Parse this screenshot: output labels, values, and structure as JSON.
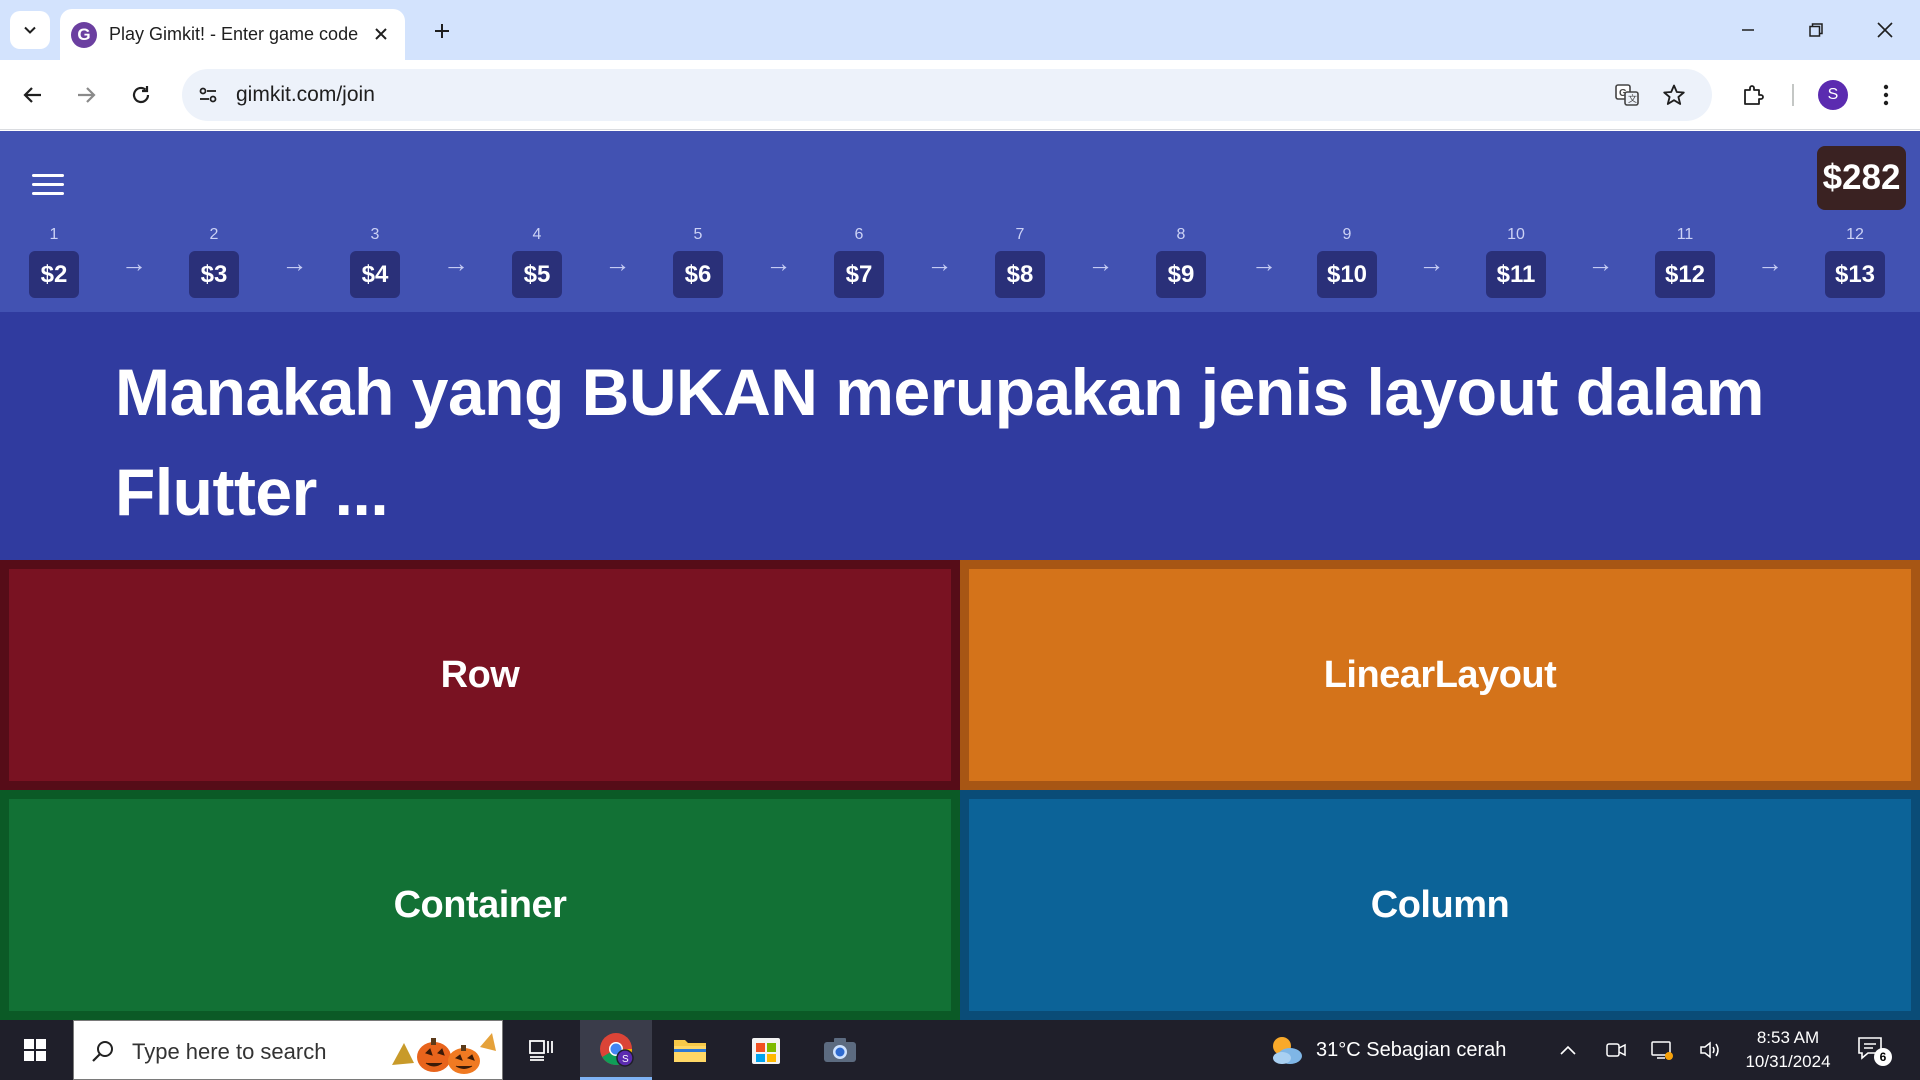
{
  "browser": {
    "tab_title": "Play Gimkit! - Enter game code",
    "favicon_letter": "G",
    "url": "gimkit.com/join",
    "profile_initial": "S"
  },
  "game": {
    "balance": "$282",
    "levels": [
      {
        "num": "1",
        "value": "$2"
      },
      {
        "num": "2",
        "value": "$3"
      },
      {
        "num": "3",
        "value": "$4"
      },
      {
        "num": "4",
        "value": "$5"
      },
      {
        "num": "5",
        "value": "$6"
      },
      {
        "num": "6",
        "value": "$7"
      },
      {
        "num": "7",
        "value": "$8"
      },
      {
        "num": "8",
        "value": "$9"
      },
      {
        "num": "9",
        "value": "$10"
      },
      {
        "num": "10",
        "value": "$11"
      },
      {
        "num": "11",
        "value": "$12"
      },
      {
        "num": "12",
        "value": "$13"
      }
    ],
    "arrow": "→",
    "question": "Manakah yang BUKAN merupakan jenis layout dalam Flutter ...",
    "answers": [
      {
        "label": "Row",
        "color": "#791222",
        "border": "#560c18"
      },
      {
        "label": "LinearLayout",
        "color": "#d4731a",
        "border": "#a75614"
      },
      {
        "label": "Container",
        "color": "#127135",
        "border": "#0b5a26"
      },
      {
        "label": "Column",
        "color": "#0c6398",
        "border": "#0a4c77"
      }
    ]
  },
  "taskbar": {
    "search_placeholder": "Type here to search",
    "weather": "31°C  Sebagian cerah",
    "time": "8:53 AM",
    "date": "10/31/2024",
    "notification_count": "6"
  },
  "icons": [
    "chevron-down-icon",
    "close-icon",
    "plus-icon",
    "back-icon",
    "forward-icon",
    "reload-icon",
    "site-info-icon",
    "translate-icon",
    "star-icon",
    "extensions-icon",
    "more-vert-icon",
    "menu-icon",
    "windows-icon",
    "search-icon",
    "task-view-icon",
    "chrome-icon",
    "file-explorer-icon",
    "store-icon",
    "camera-icon",
    "weather-icon"
  ]
}
